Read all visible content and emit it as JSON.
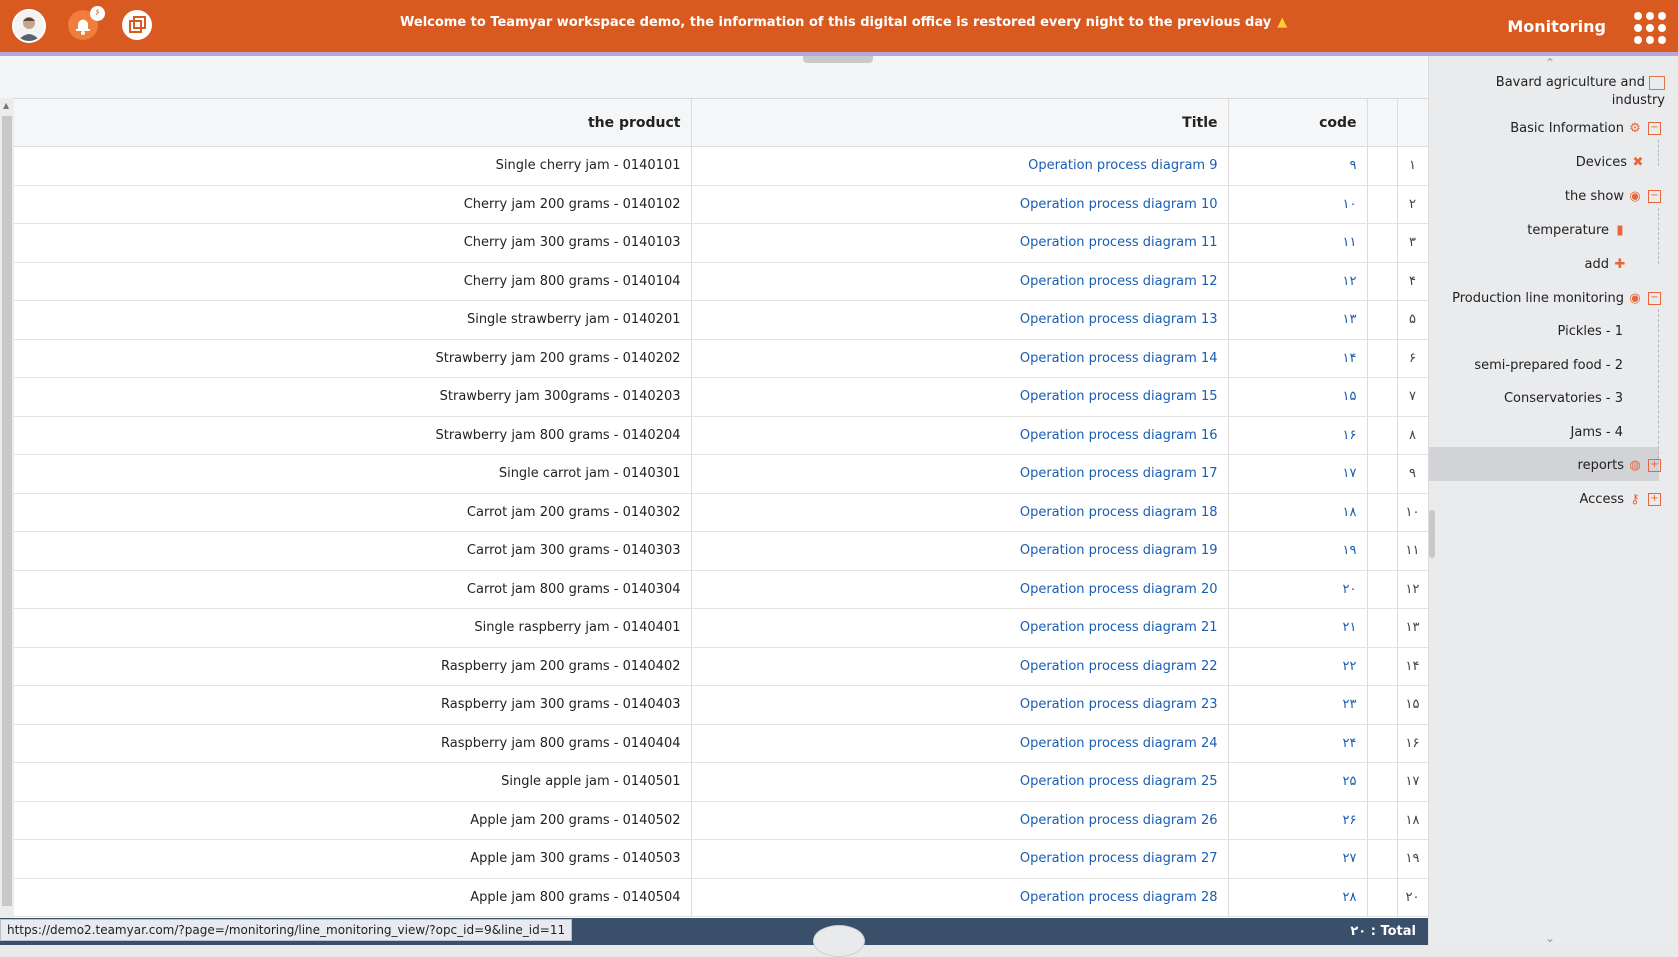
{
  "topbar": {
    "notification_count": "۶",
    "welcome": "Welcome to Teamyar workspace demo, the information of this digital office is restored every night to the previous day",
    "app_title": "Monitoring",
    "accent": "#d95a20"
  },
  "table": {
    "headers": {
      "product": "the product",
      "title": "Title",
      "code": "code"
    },
    "rows": [
      {
        "idx": "۱",
        "code": "۹",
        "title": "Operation process diagram 9",
        "product": "Single cherry jam - 0140101"
      },
      {
        "idx": "۲",
        "code": "۱۰",
        "title": "Operation process diagram 10",
        "product": "Cherry jam 200 grams - 0140102"
      },
      {
        "idx": "۳",
        "code": "۱۱",
        "title": "Operation process diagram 11",
        "product": "Cherry jam 300 grams - 0140103"
      },
      {
        "idx": "۴",
        "code": "۱۲",
        "title": "Operation process diagram 12",
        "product": "Cherry jam 800 grams - 0140104"
      },
      {
        "idx": "۵",
        "code": "۱۳",
        "title": "Operation process diagram 13",
        "product": "Single strawberry jam - 0140201"
      },
      {
        "idx": "۶",
        "code": "۱۴",
        "title": "Operation process diagram 14",
        "product": "Strawberry jam 200 grams - 0140202"
      },
      {
        "idx": "۷",
        "code": "۱۵",
        "title": "Operation process diagram 15",
        "product": "Strawberry jam 300grams - 0140203"
      },
      {
        "idx": "۸",
        "code": "۱۶",
        "title": "Operation process diagram 16",
        "product": "Strawberry jam 800 grams - 0140204"
      },
      {
        "idx": "۹",
        "code": "۱۷",
        "title": "Operation process diagram 17",
        "product": "Single carrot jam - 0140301"
      },
      {
        "idx": "۱۰",
        "code": "۱۸",
        "title": "Operation process diagram 18",
        "product": "Carrot jam 200 grams - 0140302"
      },
      {
        "idx": "۱۱",
        "code": "۱۹",
        "title": "Operation process diagram 19",
        "product": "Carrot jam 300 grams - 0140303"
      },
      {
        "idx": "۱۲",
        "code": "۲۰",
        "title": "Operation process diagram 20",
        "product": "Carrot jam 800 grams - 0140304"
      },
      {
        "idx": "۱۳",
        "code": "۲۱",
        "title": "Operation process diagram 21",
        "product": "Single raspberry jam - 0140401"
      },
      {
        "idx": "۱۴",
        "code": "۲۲",
        "title": "Operation process diagram 22",
        "product": "Raspberry jam 200 grams - 0140402"
      },
      {
        "idx": "۱۵",
        "code": "۲۳",
        "title": "Operation process diagram 23",
        "product": "Raspberry jam 300 grams - 0140403"
      },
      {
        "idx": "۱۶",
        "code": "۲۴",
        "title": "Operation process diagram 24",
        "product": "Raspberry jam 800 grams - 0140404"
      },
      {
        "idx": "۱۷",
        "code": "۲۵",
        "title": "Operation process diagram 25",
        "product": "Single apple jam - 0140501"
      },
      {
        "idx": "۱۸",
        "code": "۲۶",
        "title": "Operation process diagram 26",
        "product": "Apple jam 200 grams - 0140502"
      },
      {
        "idx": "۱۹",
        "code": "۲۷",
        "title": "Operation process diagram 27",
        "product": "Apple jam 300 grams - 0140503"
      },
      {
        "idx": "۲۰",
        "code": "۲۸",
        "title": "Operation process diagram 28",
        "product": "Apple jam 800 grams - 0140504"
      }
    ]
  },
  "footer": {
    "total": "۲۰ : Total",
    "status_url": "https://demo2.teamyar.com/?page=/monitoring/line_monitoring_view/?opc_id=9&line_id=11"
  },
  "sidebar": {
    "company_line1": "Bavard  agriculture and",
    "company_line2": "industry",
    "basic_information": "Basic Information",
    "devices": "Devices",
    "the_show": "the show",
    "temperature": "temperature",
    "add": "add",
    "production_line_monitoring": "Production line monitoring",
    "pickles": "Pickles - 1",
    "semi_prepared": "semi-prepared food - 2",
    "conservatories": "Conservatories - 3",
    "jams": "Jams - 4",
    "reports": "reports",
    "access": "Access"
  }
}
